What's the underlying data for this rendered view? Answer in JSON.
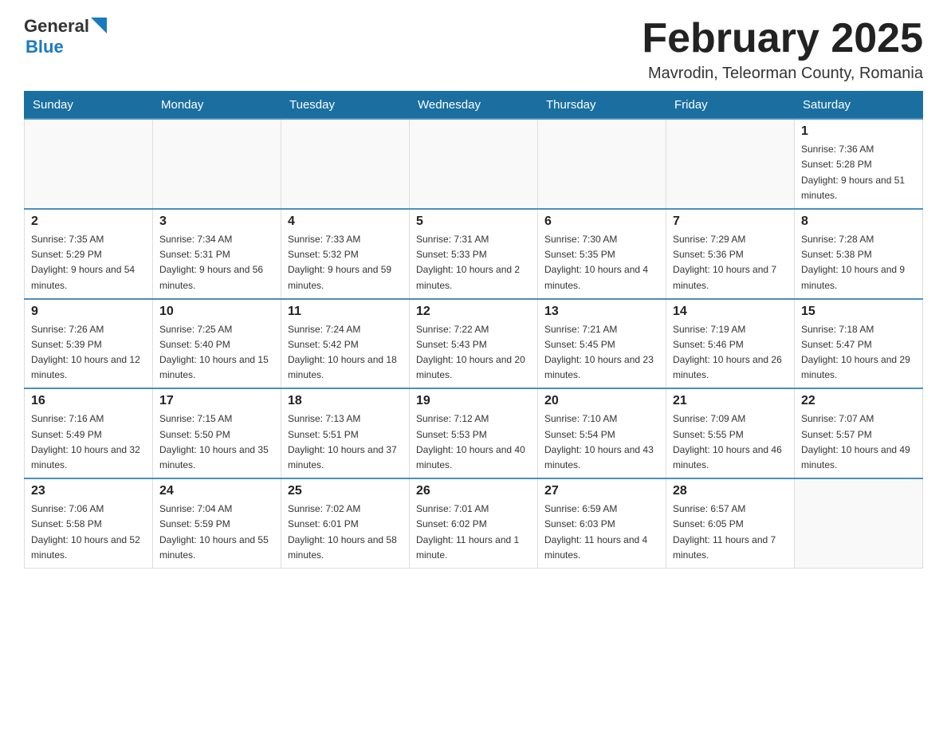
{
  "header": {
    "title": "February 2025",
    "subtitle": "Mavrodin, Teleorman County, Romania"
  },
  "logo": {
    "general": "General",
    "blue": "Blue"
  },
  "days_of_week": [
    "Sunday",
    "Monday",
    "Tuesday",
    "Wednesday",
    "Thursday",
    "Friday",
    "Saturday"
  ],
  "weeks": [
    [
      {
        "day": "",
        "info": ""
      },
      {
        "day": "",
        "info": ""
      },
      {
        "day": "",
        "info": ""
      },
      {
        "day": "",
        "info": ""
      },
      {
        "day": "",
        "info": ""
      },
      {
        "day": "",
        "info": ""
      },
      {
        "day": "1",
        "info": "Sunrise: 7:36 AM\nSunset: 5:28 PM\nDaylight: 9 hours and 51 minutes."
      }
    ],
    [
      {
        "day": "2",
        "info": "Sunrise: 7:35 AM\nSunset: 5:29 PM\nDaylight: 9 hours and 54 minutes."
      },
      {
        "day": "3",
        "info": "Sunrise: 7:34 AM\nSunset: 5:31 PM\nDaylight: 9 hours and 56 minutes."
      },
      {
        "day": "4",
        "info": "Sunrise: 7:33 AM\nSunset: 5:32 PM\nDaylight: 9 hours and 59 minutes."
      },
      {
        "day": "5",
        "info": "Sunrise: 7:31 AM\nSunset: 5:33 PM\nDaylight: 10 hours and 2 minutes."
      },
      {
        "day": "6",
        "info": "Sunrise: 7:30 AM\nSunset: 5:35 PM\nDaylight: 10 hours and 4 minutes."
      },
      {
        "day": "7",
        "info": "Sunrise: 7:29 AM\nSunset: 5:36 PM\nDaylight: 10 hours and 7 minutes."
      },
      {
        "day": "8",
        "info": "Sunrise: 7:28 AM\nSunset: 5:38 PM\nDaylight: 10 hours and 9 minutes."
      }
    ],
    [
      {
        "day": "9",
        "info": "Sunrise: 7:26 AM\nSunset: 5:39 PM\nDaylight: 10 hours and 12 minutes."
      },
      {
        "day": "10",
        "info": "Sunrise: 7:25 AM\nSunset: 5:40 PM\nDaylight: 10 hours and 15 minutes."
      },
      {
        "day": "11",
        "info": "Sunrise: 7:24 AM\nSunset: 5:42 PM\nDaylight: 10 hours and 18 minutes."
      },
      {
        "day": "12",
        "info": "Sunrise: 7:22 AM\nSunset: 5:43 PM\nDaylight: 10 hours and 20 minutes."
      },
      {
        "day": "13",
        "info": "Sunrise: 7:21 AM\nSunset: 5:45 PM\nDaylight: 10 hours and 23 minutes."
      },
      {
        "day": "14",
        "info": "Sunrise: 7:19 AM\nSunset: 5:46 PM\nDaylight: 10 hours and 26 minutes."
      },
      {
        "day": "15",
        "info": "Sunrise: 7:18 AM\nSunset: 5:47 PM\nDaylight: 10 hours and 29 minutes."
      }
    ],
    [
      {
        "day": "16",
        "info": "Sunrise: 7:16 AM\nSunset: 5:49 PM\nDaylight: 10 hours and 32 minutes."
      },
      {
        "day": "17",
        "info": "Sunrise: 7:15 AM\nSunset: 5:50 PM\nDaylight: 10 hours and 35 minutes."
      },
      {
        "day": "18",
        "info": "Sunrise: 7:13 AM\nSunset: 5:51 PM\nDaylight: 10 hours and 37 minutes."
      },
      {
        "day": "19",
        "info": "Sunrise: 7:12 AM\nSunset: 5:53 PM\nDaylight: 10 hours and 40 minutes."
      },
      {
        "day": "20",
        "info": "Sunrise: 7:10 AM\nSunset: 5:54 PM\nDaylight: 10 hours and 43 minutes."
      },
      {
        "day": "21",
        "info": "Sunrise: 7:09 AM\nSunset: 5:55 PM\nDaylight: 10 hours and 46 minutes."
      },
      {
        "day": "22",
        "info": "Sunrise: 7:07 AM\nSunset: 5:57 PM\nDaylight: 10 hours and 49 minutes."
      }
    ],
    [
      {
        "day": "23",
        "info": "Sunrise: 7:06 AM\nSunset: 5:58 PM\nDaylight: 10 hours and 52 minutes."
      },
      {
        "day": "24",
        "info": "Sunrise: 7:04 AM\nSunset: 5:59 PM\nDaylight: 10 hours and 55 minutes."
      },
      {
        "day": "25",
        "info": "Sunrise: 7:02 AM\nSunset: 6:01 PM\nDaylight: 10 hours and 58 minutes."
      },
      {
        "day": "26",
        "info": "Sunrise: 7:01 AM\nSunset: 6:02 PM\nDaylight: 11 hours and 1 minute."
      },
      {
        "day": "27",
        "info": "Sunrise: 6:59 AM\nSunset: 6:03 PM\nDaylight: 11 hours and 4 minutes."
      },
      {
        "day": "28",
        "info": "Sunrise: 6:57 AM\nSunset: 6:05 PM\nDaylight: 11 hours and 7 minutes."
      },
      {
        "day": "",
        "info": ""
      }
    ]
  ]
}
